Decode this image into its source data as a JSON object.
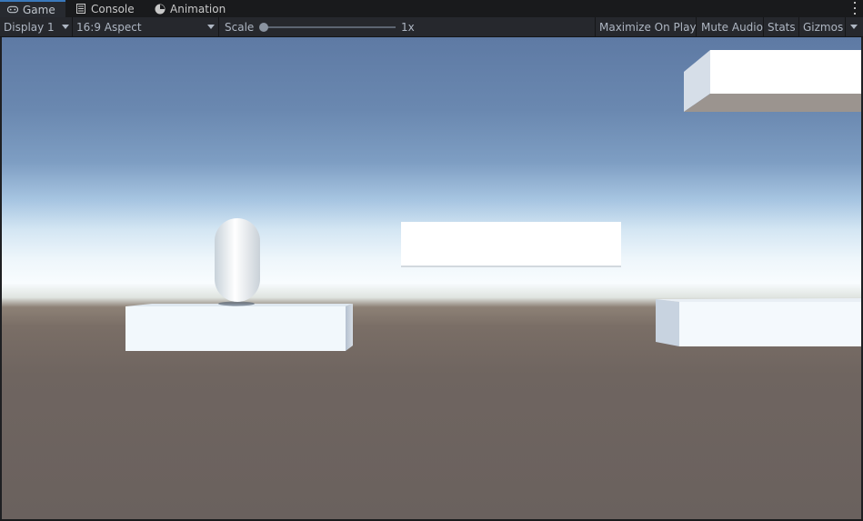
{
  "tabs": [
    {
      "label": "Game",
      "icon": "gamepad-icon",
      "active": true
    },
    {
      "label": "Console",
      "icon": "console-icon",
      "active": false
    },
    {
      "label": "Animation",
      "icon": "animation-icon",
      "active": false
    }
  ],
  "toolbar": {
    "display": "Display 1",
    "aspect": "16:9 Aspect",
    "scale_label": "Scale",
    "scale_value": "1x",
    "scale_fraction": 0.0,
    "maximize": "Maximize On Play",
    "mute": "Mute Audio",
    "stats": "Stats",
    "gizmos": "Gizmos"
  },
  "colors": {
    "accent": "#3a79bb",
    "sky_top": "#5e7aa4",
    "horizon": "#f8fcfe",
    "ground": "#6a615e",
    "platform": "#f2f8fc"
  },
  "scene_objects": [
    "player-capsule",
    "start-platform",
    "floating-platform",
    "right-platform",
    "top-right-platform"
  ]
}
